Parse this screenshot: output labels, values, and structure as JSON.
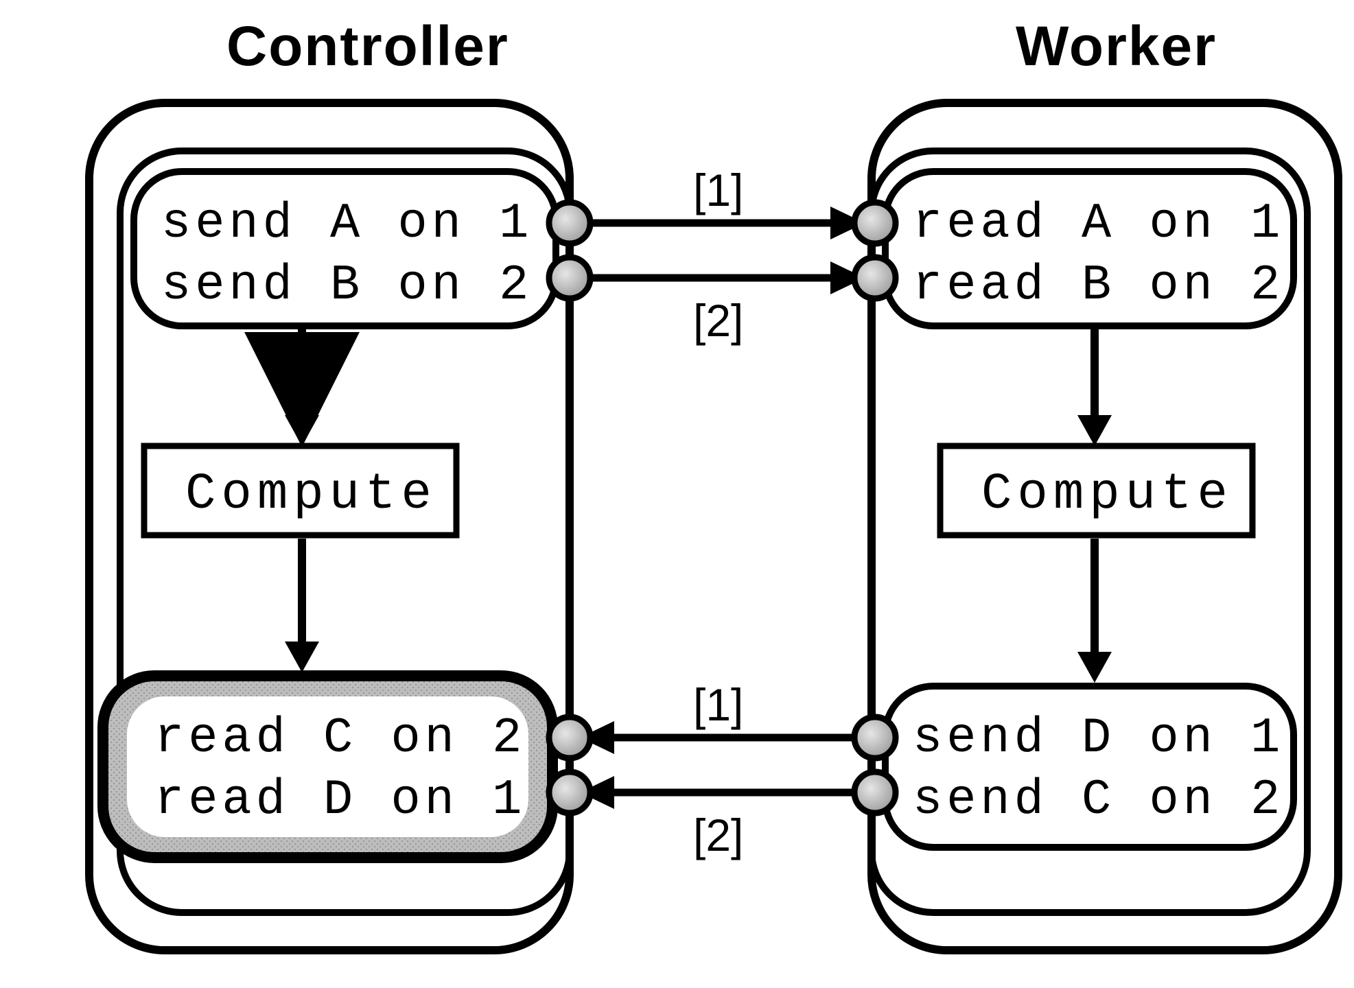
{
  "controller": {
    "title": "Controller",
    "top": {
      "line1": "send A on 1",
      "line2": "send B on 2"
    },
    "compute": "Compute",
    "bottom": {
      "line1": "read C on 2",
      "line2": "read D on 1"
    },
    "bottom_highlighted": true
  },
  "worker": {
    "title": "Worker",
    "top": {
      "line1": "read A on 1",
      "line2": "read B on 2"
    },
    "compute": "Compute",
    "bottom": {
      "line1": "send D on 1",
      "line2": "send C on 2"
    }
  },
  "channels": {
    "top_upper": "[1]",
    "top_lower": "[2]",
    "bottom_upper": "[1]",
    "bottom_lower": "[2]"
  },
  "colors": {
    "stroke": "#000000",
    "port_fill": "#c0c0c0",
    "highlight_fill": "#b0b0b0"
  }
}
